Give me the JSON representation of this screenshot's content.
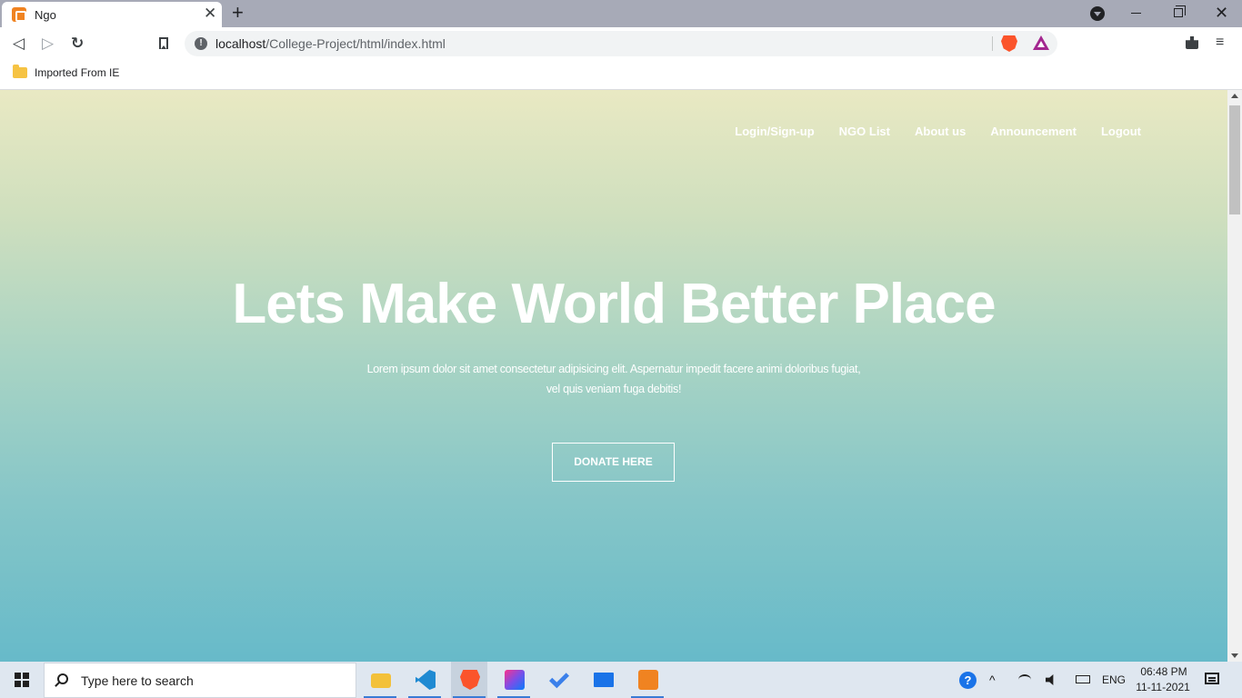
{
  "browser": {
    "tab_title": "Ngo",
    "tab_close": "✕",
    "new_tab": "+",
    "url_host": "localhost",
    "url_path": "/College-Project/html/index.html",
    "info_glyph": "!",
    "bookmark_folder": "Imported From IE",
    "back_glyph": "◁",
    "forward_glyph": "▷",
    "reload_glyph": "↻",
    "menu_glyph": "≡",
    "close_glyph": "✕"
  },
  "site": {
    "nav": [
      "Login/Sign-up",
      "NGO List",
      "About us",
      "Announcement",
      "Logout"
    ],
    "hero_title": "Lets Make World Better Place",
    "hero_sub_1": "Lorem ipsum dolor sit amet consectetur adipisicing elit. Aspernatur impedit facere animi doloribus fugiat,",
    "hero_sub_2": "vel quis veniam fuga debitis!",
    "donate_label": "DONATE HERE"
  },
  "taskbar": {
    "search_placeholder": "Type here to search",
    "apps": [
      "file-explorer-icon",
      "vscode-icon",
      "brave-icon",
      "intellij-icon",
      "todo-icon",
      "mail-icon",
      "xampp-icon"
    ],
    "help_glyph": "?",
    "chevron_glyph": "^",
    "language": "ENG",
    "time": "06:48 PM",
    "date": "11-11-2021"
  },
  "colors": {
    "gradient_top": "#e9e9c3",
    "gradient_bottom": "#67bac9",
    "tab_bar": "#a7aab7"
  }
}
